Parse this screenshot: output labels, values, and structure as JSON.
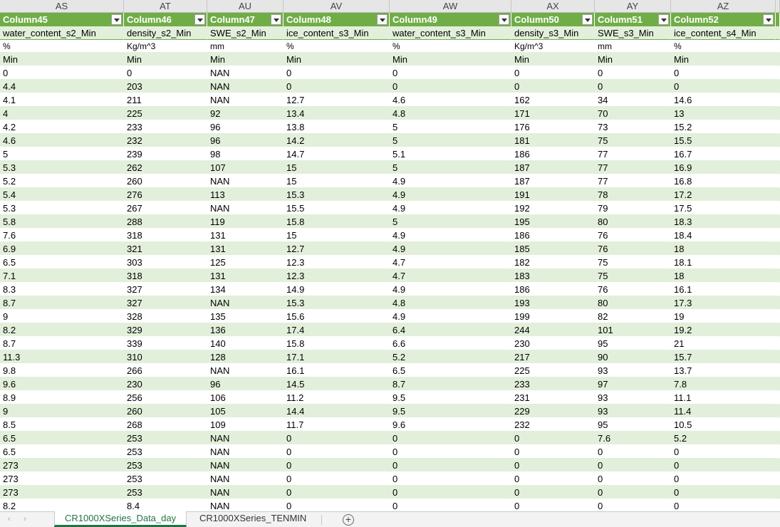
{
  "column_letters": [
    "AS",
    "AT",
    "AU",
    "AV",
    "AW",
    "AX",
    "AY",
    "AZ",
    ""
  ],
  "filter_headers": [
    "Column45",
    "Column46",
    "Column47",
    "Column48",
    "Column49",
    "Column50",
    "Column51",
    "Column52"
  ],
  "field_names": [
    "water_content_s2_Min",
    "density_s2_Min",
    "SWE_s2_Min",
    "ice_content_s3_Min",
    "water_content_s3_Min",
    "density_s3_Min",
    "SWE_s3_Min",
    "ice_content_s4_Min"
  ],
  "units": [
    "%",
    "Kg/m^3",
    "mm",
    "%",
    "%",
    "Kg/m^3",
    "mm",
    "%"
  ],
  "agg_types": [
    "Min",
    "Min",
    "Min",
    "Min",
    "Min",
    "Min",
    "Min",
    "Min"
  ],
  "rows": [
    [
      "0",
      "0",
      "NAN",
      "0",
      "0",
      "0",
      "0",
      "0"
    ],
    [
      "4.4",
      "203",
      "NAN",
      "0",
      "0",
      "0",
      "0",
      "0"
    ],
    [
      "4.1",
      "211",
      "NAN",
      "12.7",
      "4.6",
      "162",
      "34",
      "14.6"
    ],
    [
      "4",
      "225",
      "92",
      "13.4",
      "4.8",
      "171",
      "70",
      "13"
    ],
    [
      "4.2",
      "233",
      "96",
      "13.8",
      "5",
      "176",
      "73",
      "15.2"
    ],
    [
      "4.6",
      "232",
      "96",
      "14.2",
      "5",
      "181",
      "75",
      "15.5"
    ],
    [
      "5",
      "239",
      "98",
      "14.7",
      "5.1",
      "186",
      "77",
      "16.7"
    ],
    [
      "5.3",
      "262",
      "107",
      "15",
      "5",
      "187",
      "77",
      "16.9"
    ],
    [
      "5.2",
      "260",
      "NAN",
      "15",
      "4.9",
      "187",
      "77",
      "16.8"
    ],
    [
      "5.4",
      "276",
      "113",
      "15.3",
      "4.9",
      "191",
      "78",
      "17.2"
    ],
    [
      "5.3",
      "267",
      "NAN",
      "15.5",
      "4.9",
      "192",
      "79",
      "17.5"
    ],
    [
      "5.8",
      "288",
      "119",
      "15.8",
      "5",
      "195",
      "80",
      "18.3"
    ],
    [
      "7.6",
      "318",
      "131",
      "15",
      "4.9",
      "186",
      "76",
      "18.4"
    ],
    [
      "6.9",
      "321",
      "131",
      "12.7",
      "4.9",
      "185",
      "76",
      "18"
    ],
    [
      "6.5",
      "303",
      "125",
      "12.3",
      "4.7",
      "182",
      "75",
      "18.1"
    ],
    [
      "7.1",
      "318",
      "131",
      "12.3",
      "4.7",
      "183",
      "75",
      "18"
    ],
    [
      "8.3",
      "327",
      "134",
      "14.9",
      "4.9",
      "186",
      "76",
      "16.1"
    ],
    [
      "8.7",
      "327",
      "NAN",
      "15.3",
      "4.8",
      "193",
      "80",
      "17.3"
    ],
    [
      "9",
      "328",
      "135",
      "15.6",
      "4.9",
      "199",
      "82",
      "19"
    ],
    [
      "8.2",
      "329",
      "136",
      "17.4",
      "6.4",
      "244",
      "101",
      "19.2"
    ],
    [
      "8.7",
      "339",
      "140",
      "15.8",
      "6.6",
      "230",
      "95",
      "21"
    ],
    [
      "11.3",
      "310",
      "128",
      "17.1",
      "5.2",
      "217",
      "90",
      "15.7"
    ],
    [
      "9.8",
      "266",
      "NAN",
      "16.1",
      "6.5",
      "225",
      "93",
      "13.7"
    ],
    [
      "9.6",
      "230",
      "96",
      "14.5",
      "8.7",
      "233",
      "97",
      "7.8"
    ],
    [
      "8.9",
      "256",
      "106",
      "11.2",
      "9.5",
      "231",
      "93",
      "11.1"
    ],
    [
      "9",
      "260",
      "105",
      "14.4",
      "9.5",
      "229",
      "93",
      "11.4"
    ],
    [
      "8.5",
      "268",
      "109",
      "11.7",
      "9.6",
      "232",
      "95",
      "10.5"
    ],
    [
      "6.5",
      "253",
      "NAN",
      "0",
      "0",
      "0",
      "7.6",
      "5.2"
    ],
    [
      "6.5",
      "253",
      "NAN",
      "0",
      "0",
      "0",
      "0",
      "0"
    ],
    [
      "273",
      "253",
      "NAN",
      "0",
      "0",
      "0",
      "0",
      "0"
    ],
    [
      "273",
      "253",
      "NAN",
      "0",
      "0",
      "0",
      "0",
      "0"
    ],
    [
      "273",
      "253",
      "NAN",
      "0",
      "0",
      "0",
      "0",
      "0"
    ],
    [
      "8.2",
      "8.4",
      "NAN",
      "0",
      "0",
      "0",
      "0",
      "0"
    ]
  ],
  "sheet_tabs": [
    {
      "label": "CR1000XSeries_Data_day",
      "active": true
    },
    {
      "label": "CR1000XSeries_TENMIN",
      "active": false
    }
  ],
  "icons": {
    "prev_sheet": "chevron-left-icon",
    "next_sheet": "chevron-right-icon",
    "add_sheet": "plus-circle-icon",
    "filter": "filter-dropdown-icon"
  },
  "colors": {
    "header_green": "#70ad47",
    "band_green": "#e2efda",
    "active_tab_text": "#217346"
  }
}
